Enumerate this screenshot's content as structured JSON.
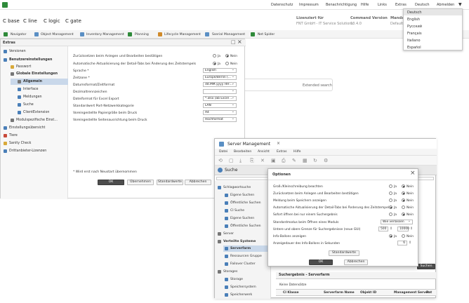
{
  "topbar": {
    "links": [
      "Datenschutz",
      "Impressum",
      "Benachrichtigung",
      "Hilfe",
      "Links",
      "Extras",
      "Deutsch",
      "Abmelden"
    ]
  },
  "products": [
    "C base",
    "C line",
    "C logic",
    "C gate"
  ],
  "license": {
    "label": "Lizenziert für",
    "value": "FNT GmbH - IT Service Solutions"
  },
  "version": {
    "label": "Command Version",
    "value": "13.4.0"
  },
  "mandant": {
    "label": "Manda",
    "value": "Default"
  },
  "nav": [
    "Navigator",
    "Object Management",
    "Inventory Management",
    "Planning",
    "Lifecycle Management",
    "Sserial Management",
    "Net Spider"
  ],
  "languages": {
    "items": [
      "Deutsch",
      "English",
      "Русский",
      "Français",
      "Italiano",
      "Español"
    ],
    "selected": "Deutsch"
  },
  "extras": {
    "title": "Extras",
    "tree": [
      {
        "label": "Versionen",
        "level": 0
      },
      {
        "label": "Benutzereinstellungen",
        "level": 0
      },
      {
        "label": "Passwort",
        "level": 1
      },
      {
        "label": "Globale Einstellungen",
        "level": 1
      },
      {
        "label": "Allgemein",
        "level": 2
      },
      {
        "label": "Interface",
        "level": 2
      },
      {
        "label": "Meldungen",
        "level": 2
      },
      {
        "label": "Suche",
        "level": 2
      },
      {
        "label": "ClientExtension",
        "level": 2
      },
      {
        "label": "Modulspezifische Einst...",
        "level": 1
      },
      {
        "label": "Einstellungsübersicht",
        "level": 0
      },
      {
        "label": "Tiere",
        "level": 0
      },
      {
        "label": "Sanity Check",
        "level": 0
      },
      {
        "label": "Drittanbieter-Lizenzen",
        "level": 0
      }
    ],
    "settings": [
      "Zurücksetzen beim Anlegen und Bearbeiten bestätigen",
      "Automatische Aktualisierung der Detail-Tabs bei Änderung des Zeitstempels",
      "Sprache *",
      "Zeitzone *",
      "Datumsformat/Zeitformat",
      "Dezimaltrennzeichen",
      "Dateiformat für Excel Export",
      "Standardwert Port-Netzwerkkategorie",
      "Voreingestellte Papiergröße beim Druck",
      "Voreingestellte Seitenausrichtung beim Druck"
    ],
    "values": [
      "English",
      "Europe/Berlin (...",
      "dd.MM.yyyy HH:...",
      "",
      "*.xlsx (ab Excel ...",
      "LAN",
      "A4",
      "Hochformat"
    ],
    "radio_yes": "Ja",
    "radio_no": "Nein",
    "footnote": "* Wird erst nach Neustart übernommen",
    "buttons": [
      "OK",
      "Übernehmen",
      "Standardwerte",
      "Abbrechen"
    ]
  },
  "extended_search": "Extended search",
  "server": {
    "title": "Server Management",
    "menu": [
      "Datei",
      "Bearbeiten",
      "Ansicht",
      "Extras",
      "Hilfe"
    ],
    "tab": "Suche",
    "sidebar": [
      {
        "label": "Schlagwortsuche",
        "level": 0
      },
      {
        "label": "Eigene Suchen",
        "level": 1
      },
      {
        "label": "Öffentliche Suchen",
        "level": 1
      },
      {
        "label": "CI Suche",
        "level": 0
      },
      {
        "label": "Eigene Suchen",
        "level": 1
      },
      {
        "label": "Öffentliche Suchen",
        "level": 1
      },
      {
        "label": "Server",
        "level": 0
      },
      {
        "label": "Verteilte Systeme",
        "level": 0
      },
      {
        "label": "Serverfarm",
        "level": 1
      },
      {
        "label": "Ressourcen Gruppe",
        "level": 1
      },
      {
        "label": "Failover Cluster",
        "level": 1
      },
      {
        "label": "Storages",
        "level": 0
      },
      {
        "label": "Storage",
        "level": 1
      },
      {
        "label": "Speichersystem",
        "level": 1
      },
      {
        "label": "Speicherwerk",
        "level": 1
      }
    ],
    "search_btn": "Suchen",
    "result_title": "Suchergebnis - Serverfarm",
    "datasets": "Keine Datensätze",
    "columns": [
      "CI Klasse",
      "Serverfarm Name",
      "Objekt ID",
      "Management Server",
      "Pat"
    ]
  },
  "options": {
    "title": "Optionen",
    "rows": [
      "Groß-/Kleinschreibung beachten",
      "Zurücksetzen beim Anlegen und Bearbeiten bestätigen",
      "Meldung beim Speichern anzeigen",
      "Automatische Aktualisierung der Detail-Tabs bei Änderung des Zeitstempels",
      "Sofort öffnen bei nur einem Suchergebnis",
      "Standardmodus beim Öffnen eines Moduls",
      "Untere und obere Grenze für Suchergebnisse (neue GUI)",
      "Info-Ballons anzeigen",
      "Anzeigedauer des Info-Ballons in Sekunden"
    ],
    "mode": "Wie verlassen",
    "lower": "500",
    "upper": "10000",
    "seconds": "6",
    "standard_btn": "Standardwerte",
    "ok": "OK",
    "cancel": "Abbrechen",
    "yes": "Ja",
    "no": "Nein"
  }
}
